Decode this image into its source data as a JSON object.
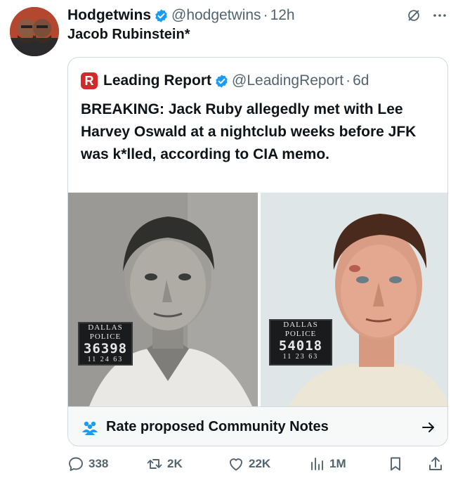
{
  "tweet": {
    "author_name": "Hodgetwins",
    "handle": "@hodgetwins",
    "separator": "·",
    "time": "12h",
    "text": "Jacob Rubinstein*",
    "avatar_icon": "avatar-photo",
    "more_icon": "more-icon",
    "grok_icon": "grok-icon"
  },
  "quote": {
    "author_name": "Leading Report",
    "logo_letter": "R",
    "handle": "@LeadingReport",
    "separator": "·",
    "time": "6d",
    "text": "BREAKING: Jack Ruby allegedly met with Lee Harvey Oswald at a nightclub weeks before JFK was k*lled, according to CIA memo.",
    "photos": [
      {
        "placard_line1": "DALLAS",
        "placard_line2": "POLICE",
        "placard_number": "36398",
        "placard_date": "11 24 63"
      },
      {
        "placard_line1": "DALLAS",
        "placard_line2": "POLICE",
        "placard_number": "54018",
        "placard_date": "11 23 63"
      }
    ],
    "community_notes_label": "Rate proposed Community Notes"
  },
  "actions": {
    "replies": "338",
    "retweets": "2K",
    "likes": "22K",
    "views": "1M"
  },
  "colors": {
    "text": "#0f1419",
    "secondary": "#536471",
    "verified": "#1d9bf0",
    "border": "#cfd9de",
    "logo_red": "#d12a2a"
  }
}
